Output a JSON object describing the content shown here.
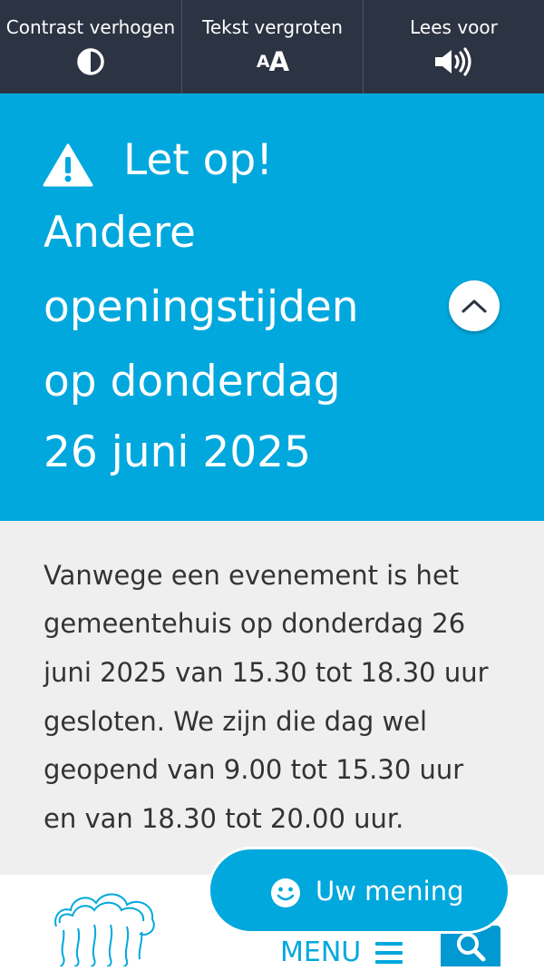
{
  "toolbar": {
    "contrast_label": "Contrast verhogen",
    "text_size_label": "Tekst vergroten",
    "text_size_glyph_small": "A",
    "text_size_glyph_big": "A",
    "read_aloud_label": "Lees voor"
  },
  "alert": {
    "lines": [
      "Let op!",
      "Andere",
      "openingstijden",
      "op donderdag",
      "26 juni 2025"
    ],
    "message_lines": [
      "Vanwege een evenement is het",
      "gemeentehuis op donderdag 26",
      "juni 2025 van 15.30 tot 18.30 uur",
      "gesloten. We zijn die dag wel",
      "geopend van 9.00 tot 15.30 uur",
      "en van 18.30 tot 20.00 uur."
    ]
  },
  "feedback": {
    "label": "Uw mening"
  },
  "nav": {
    "menu_label": "MENU"
  },
  "colors": {
    "toolbar": "#2c3342",
    "accent": "#00a8dd",
    "message_bg": "#efefef"
  },
  "icons": [
    "contrast-icon",
    "text-size-icon",
    "speaker-icon",
    "warning-icon",
    "chevron-up-icon",
    "smiley-icon",
    "logo-icon",
    "hamburger-icon",
    "search-icon"
  ]
}
